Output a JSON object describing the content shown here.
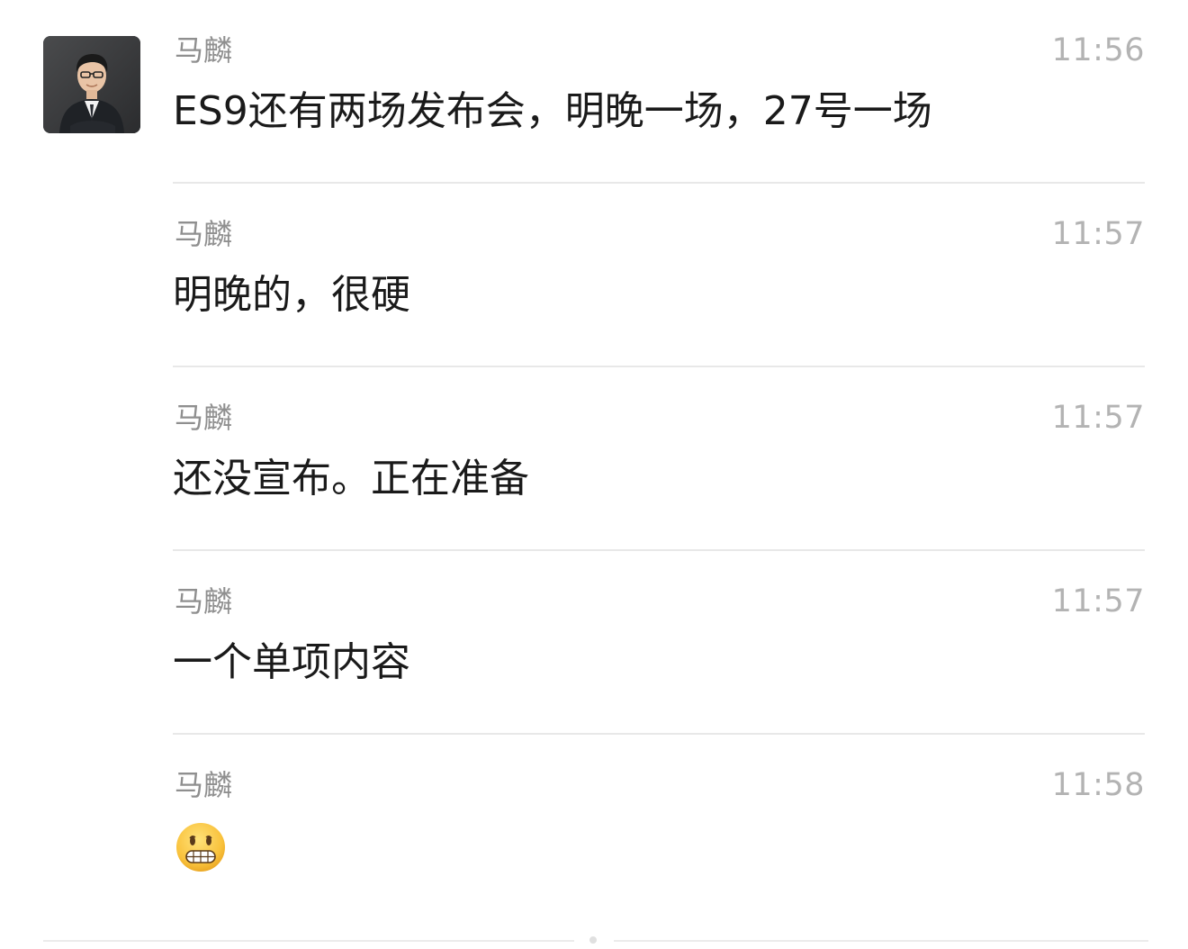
{
  "chat": {
    "avatar_icon": "person-photo-icon",
    "messages": [
      {
        "sender": "马麟",
        "time": "11:56",
        "text": "ES9还有两场发布会，明晚一场，27号一场"
      },
      {
        "sender": "马麟",
        "time": "11:57",
        "text": "明晚的，很硬"
      },
      {
        "sender": "马麟",
        "time": "11:57",
        "text": "还没宣布。正在准备"
      },
      {
        "sender": "马麟",
        "time": "11:57",
        "text": "一个单项内容"
      },
      {
        "sender": "马麟",
        "time": "11:58",
        "emoji": "grimacing-face-emoji"
      }
    ]
  },
  "colors": {
    "sender": "#8f8f8f",
    "time": "#b3b3b3",
    "text": "#1a1a1a",
    "divider": "#e8e8e8"
  }
}
